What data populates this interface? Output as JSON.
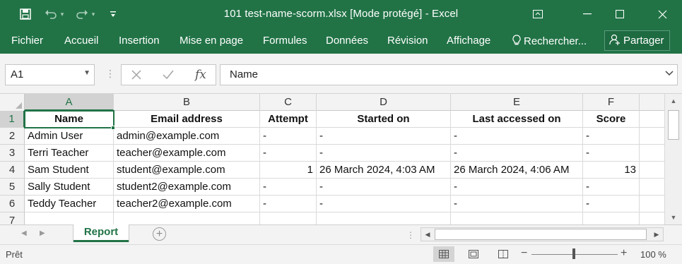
{
  "window": {
    "title": "101 test-name-scorm.xlsx  [Mode protégé]  -  Excel"
  },
  "quick_access": {
    "save_icon": "save-icon",
    "undo_icon": "undo-icon",
    "redo_icon": "redo-icon",
    "customize_icon": "customize-qat-icon"
  },
  "ribbon": {
    "tabs": [
      {
        "label": "Fichier"
      },
      {
        "label": "Accueil"
      },
      {
        "label": "Insertion"
      },
      {
        "label": "Mise en page"
      },
      {
        "label": "Formules"
      },
      {
        "label": "Données"
      },
      {
        "label": "Révision"
      },
      {
        "label": "Affichage"
      }
    ],
    "search_label": "Rechercher...",
    "share_label": "Partager"
  },
  "formula_bar": {
    "name_box": "A1",
    "cancel_icon": "cancel-icon",
    "enter_icon": "checkmark-icon",
    "fx_label": "fx",
    "content": "Name"
  },
  "grid": {
    "columns": [
      "A",
      "B",
      "C",
      "D",
      "E",
      "F"
    ],
    "rows": [
      "1",
      "2",
      "3",
      "4",
      "5",
      "6",
      "7"
    ],
    "header": [
      "Name",
      "Email address",
      "Attempt",
      "Started on",
      "Last accessed on",
      "Score"
    ],
    "data": [
      [
        "Admin User",
        "admin@example.com",
        "-",
        "-",
        "-",
        "-"
      ],
      [
        "Terri Teacher",
        "teacher@example.com",
        "-",
        "-",
        "-",
        "-"
      ],
      [
        "Sam Student",
        "student@example.com",
        "1",
        "26 March 2024, 4:03 AM",
        "26 March 2024, 4:06 AM",
        "13"
      ],
      [
        "Sally Student",
        "student2@example.com",
        "-",
        "-",
        "-",
        "-"
      ],
      [
        "Teddy Teacher",
        "teacher2@example.com",
        "-",
        "-",
        "-",
        "-"
      ]
    ],
    "selected_cell": "A1"
  },
  "sheets": {
    "tabs": [
      {
        "label": "Report"
      }
    ],
    "active": "Report"
  },
  "status": {
    "ready": "Prêt",
    "zoom": "100 %",
    "zoom_fraction": 0.5
  },
  "colors": {
    "excel_green": "#217346",
    "header_bg": "#f3f3f3"
  }
}
